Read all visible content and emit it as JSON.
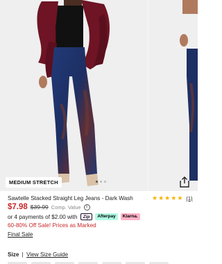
{
  "product": {
    "badge": "MEDIUM STRETCH",
    "title": "Sawtelle Stacked Straight Leg Jeans - Dark Wash",
    "rating_stars": 5,
    "review_count": "(1)",
    "price": "$7.98",
    "old_price": "$39.99",
    "comp_label": "Comp. Value",
    "installments": "or 4 payments of $2.00 with",
    "pay_zip": "Zip",
    "pay_afterpay": "Afterpay",
    "pay_klarna": "Klarna.",
    "sale_text": "60-80% Off Sale! Prices as Marked",
    "final_sale": "Final Sale",
    "size_label": "Size",
    "size_separator": "|",
    "size_guide": "View Size Guide"
  },
  "gallery": {
    "dot_count": 3,
    "active_dot": 0
  },
  "colors": {
    "sale_red": "#c62828",
    "star_gold": "#f5b300",
    "coat_burgundy": "#6e1424",
    "denim_blue": "#1d2f63",
    "denim_rust": "#7a3a2a"
  },
  "icons": {
    "share": "share-icon",
    "info": "info-icon",
    "star": "star-icon"
  }
}
